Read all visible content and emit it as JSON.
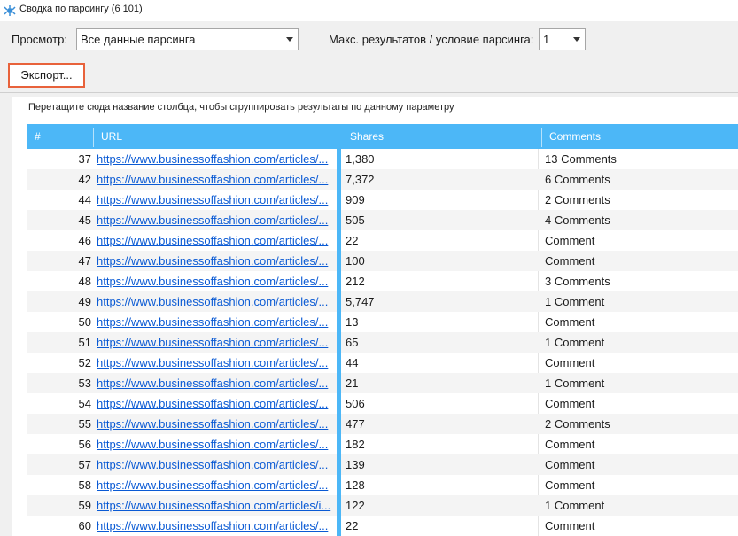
{
  "window": {
    "title": "Сводка по парсингу (6 101)"
  },
  "toolbar": {
    "view_label": "Просмотр:",
    "view_value": "Все данные парсинга",
    "max_label": "Макс. результатов / условие парсинга:",
    "max_value": "1",
    "export_label": "Экспорт..."
  },
  "grid": {
    "group_hint": "Перетащите сюда название столбца, чтобы сгруппировать результаты по данному параметру",
    "columns": {
      "num": "#",
      "url": "URL",
      "shares": "Shares",
      "comments": "Comments"
    },
    "rows": [
      {
        "num": "37",
        "url": "https://www.businessoffashion.com/articles/...",
        "shares": "1,380",
        "comments": "13 Comments"
      },
      {
        "num": "42",
        "url": "https://www.businessoffashion.com/articles/...",
        "shares": "7,372",
        "comments": "6 Comments"
      },
      {
        "num": "44",
        "url": "https://www.businessoffashion.com/articles/...",
        "shares": "909",
        "comments": "2 Comments"
      },
      {
        "num": "45",
        "url": "https://www.businessoffashion.com/articles/...",
        "shares": "505",
        "comments": "4 Comments"
      },
      {
        "num": "46",
        "url": "https://www.businessoffashion.com/articles/...",
        "shares": "22",
        "comments": "Comment"
      },
      {
        "num": "47",
        "url": "https://www.businessoffashion.com/articles/...",
        "shares": "100",
        "comments": "Comment"
      },
      {
        "num": "48",
        "url": "https://www.businessoffashion.com/articles/...",
        "shares": "212",
        "comments": "3 Comments"
      },
      {
        "num": "49",
        "url": "https://www.businessoffashion.com/articles/...",
        "shares": "5,747",
        "comments": "1 Comment"
      },
      {
        "num": "50",
        "url": "https://www.businessoffashion.com/articles/...",
        "shares": "13",
        "comments": "Comment"
      },
      {
        "num": "51",
        "url": "https://www.businessoffashion.com/articles/...",
        "shares": "65",
        "comments": "1 Comment"
      },
      {
        "num": "52",
        "url": "https://www.businessoffashion.com/articles/...",
        "shares": "44",
        "comments": "Comment"
      },
      {
        "num": "53",
        "url": "https://www.businessoffashion.com/articles/...",
        "shares": "21",
        "comments": "1 Comment"
      },
      {
        "num": "54",
        "url": "https://www.businessoffashion.com/articles/...",
        "shares": "506",
        "comments": "Comment"
      },
      {
        "num": "55",
        "url": "https://www.businessoffashion.com/articles/...",
        "shares": "477",
        "comments": "2 Comments"
      },
      {
        "num": "56",
        "url": "https://www.businessoffashion.com/articles/...",
        "shares": "182",
        "comments": "Comment"
      },
      {
        "num": "57",
        "url": "https://www.businessoffashion.com/articles/...",
        "shares": "139",
        "comments": "Comment"
      },
      {
        "num": "58",
        "url": "https://www.businessoffashion.com/articles/...",
        "shares": "128",
        "comments": "Comment"
      },
      {
        "num": "59",
        "url": "https://www.businessoffashion.com/articles/i...",
        "shares": "122",
        "comments": "1 Comment"
      },
      {
        "num": "60",
        "url": "https://www.businessoffashion.com/articles/...",
        "shares": "22",
        "comments": "Comment"
      }
    ]
  },
  "colors": {
    "header": "#4cb7f7",
    "link": "#0a5ad4",
    "export_border": "#e8623b"
  },
  "icons": {
    "app": "scrapebox-spider-icon",
    "dropdown": "chevron-down-icon",
    "column_grip": "column-grip-icon"
  }
}
